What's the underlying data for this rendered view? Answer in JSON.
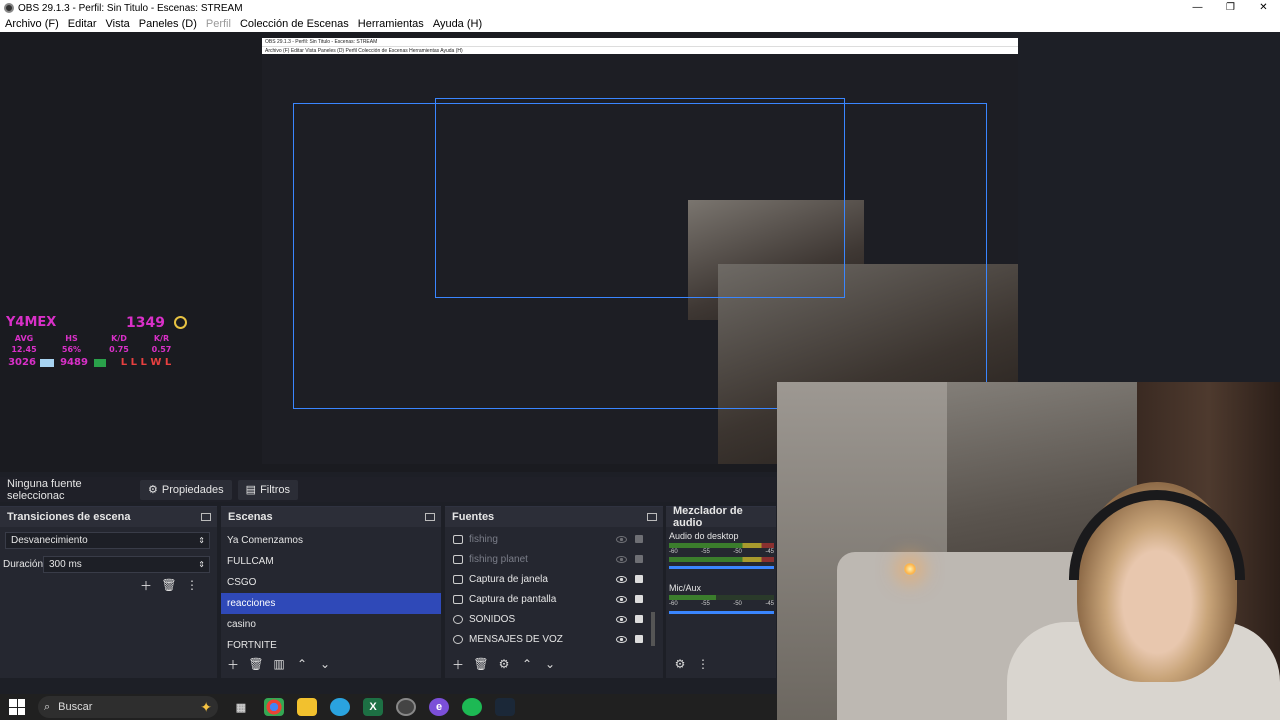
{
  "window": {
    "title": "OBS 29.1.3 - Perfil: Sin Titulo - Escenas: STREAM",
    "min": "—",
    "max": "❐",
    "close": "✕"
  },
  "menu": [
    "Archivo (F)",
    "Editar",
    "Vista",
    "Paneles (D)",
    "Perfil",
    "Colección de Escenas",
    "Herramientas",
    "Ayuda (H)"
  ],
  "preview_mini": {
    "title": "OBS 29.1.3 - Perfil: Sin Titulo - Escenas: STREAM",
    "menu": "Archivo (F)  Editar  Vista  Paneles (D)  Perfil  Colección de Escenas  Herramientas  Ayuda (H)"
  },
  "hud": {
    "name": "Y4MEX",
    "elo": "1349",
    "labels": [
      "AVG",
      "HS",
      "K/D",
      "K/R"
    ],
    "values": [
      "12.45",
      "56%",
      "0.75",
      "0.57"
    ],
    "bottom_left": "3026",
    "bottom_mid": "9489",
    "bottom_right": "L L L W L"
  },
  "props_bar": {
    "no_source": "Ninguna fuente seleccionac",
    "properties": "Propiedades",
    "filters": "Filtros"
  },
  "transitions": {
    "title": "Transiciones de escena",
    "type": "Desvanecimiento",
    "duration_label": "Duración",
    "duration_value": "300 ms"
  },
  "scenes": {
    "title": "Escenas",
    "items": [
      "Ya Comenzamos",
      "FULLCAM",
      "CSGO",
      "reacciones",
      "casino",
      "FORTNITE"
    ]
  },
  "sources": {
    "title": "Fuentes",
    "items": [
      "fishing",
      "fishing planet",
      "Captura de janela",
      "Captura de pantalla",
      "SONIDOS",
      "MENSAJES DE VOZ"
    ]
  },
  "mixer": {
    "title": "Mezclador de audio",
    "channels": [
      {
        "name": "Audio do desktop"
      },
      {
        "name": "Mic/Aux"
      }
    ],
    "scale": [
      "-60",
      "-55",
      "-50",
      "-45"
    ]
  },
  "taskbar": {
    "search_placeholder": "Buscar",
    "excel": "X",
    "edge": "e"
  }
}
